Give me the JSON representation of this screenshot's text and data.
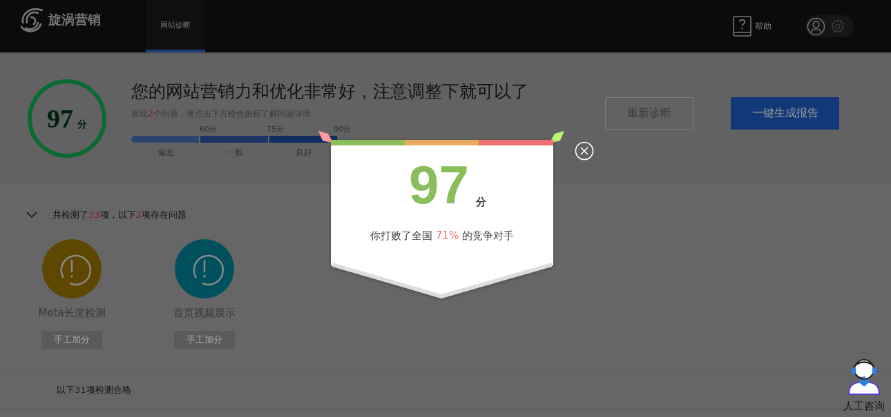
{
  "header": {
    "logo": "旋涡营销",
    "tabs": [
      {
        "label": "网站诊断",
        "selected": true
      }
    ],
    "help": "帮助"
  },
  "summary": {
    "score": "97",
    "unit": "分",
    "title": "您的网站营销力和优化非常好，注意调整下就可以了",
    "subtitle": {
      "before": "发现",
      "count": "2",
      "after": "个问题，请点击下方橙色图标了解问题详情"
    },
    "ticks": [
      "60分",
      "75分",
      "90分"
    ],
    "grades": [
      "偏差",
      "一般",
      "良好"
    ],
    "buttons": [
      {
        "label": "重新诊断",
        "kind": "outline"
      },
      {
        "label": "一键生成报告",
        "kind": "primary"
      }
    ]
  },
  "issues": {
    "expanded": true,
    "header": {
      "a": "共检测了",
      "total": "33",
      "b": "项，以下",
      "count": "2",
      "c": "项存在问题"
    },
    "items": [
      {
        "name": "Meta长度检测",
        "color": "#5e4700",
        "button": "手工加分"
      },
      {
        "name": "首页视频展示",
        "color": "#00505e",
        "button": "手工加分"
      }
    ],
    "passed": {
      "a": "以下",
      "count": "31",
      "b": "项检测合格"
    }
  },
  "modal": {
    "score": "97",
    "unit": "分",
    "before": "你打败了全国 ",
    "percent": "71%",
    "after": " 的竞争对手"
  },
  "consult": {
    "label": "人工咨询"
  }
}
